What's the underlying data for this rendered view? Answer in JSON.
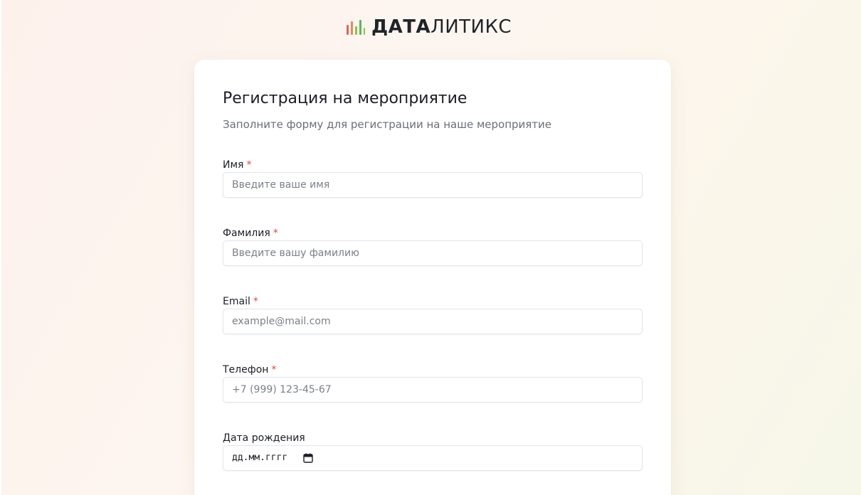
{
  "brand": {
    "name_bold": "ДАТА",
    "name_regular": "ЛИТИКС",
    "icon": "bar-chart-logo-icon",
    "bar_colors": [
      "#e06464",
      "#e58a5c",
      "#8bc34a",
      "#5cb85c"
    ]
  },
  "form": {
    "title": "Регистрация на мероприятие",
    "subtitle": "Заполните форму для регистрации на наше мероприятие",
    "required_mark": "*",
    "fields": [
      {
        "label": "Имя",
        "placeholder": "Введите ваше имя",
        "required": true
      },
      {
        "label": "Фамилия",
        "placeholder": "Введите вашу фамилию",
        "required": true
      },
      {
        "label": "Email",
        "placeholder": "example@mail.com",
        "required": true
      },
      {
        "label": "Телефон",
        "placeholder": "+7 (999) 123-45-67",
        "required": true
      },
      {
        "label": "Дата рождения",
        "placeholder": "дд.мм.гггг",
        "required": false,
        "icon": "calendar-icon"
      }
    ]
  },
  "colors": {
    "accent_required": "#e0473d",
    "text_primary": "#1b1e24",
    "text_secondary": "#6a6f76"
  }
}
